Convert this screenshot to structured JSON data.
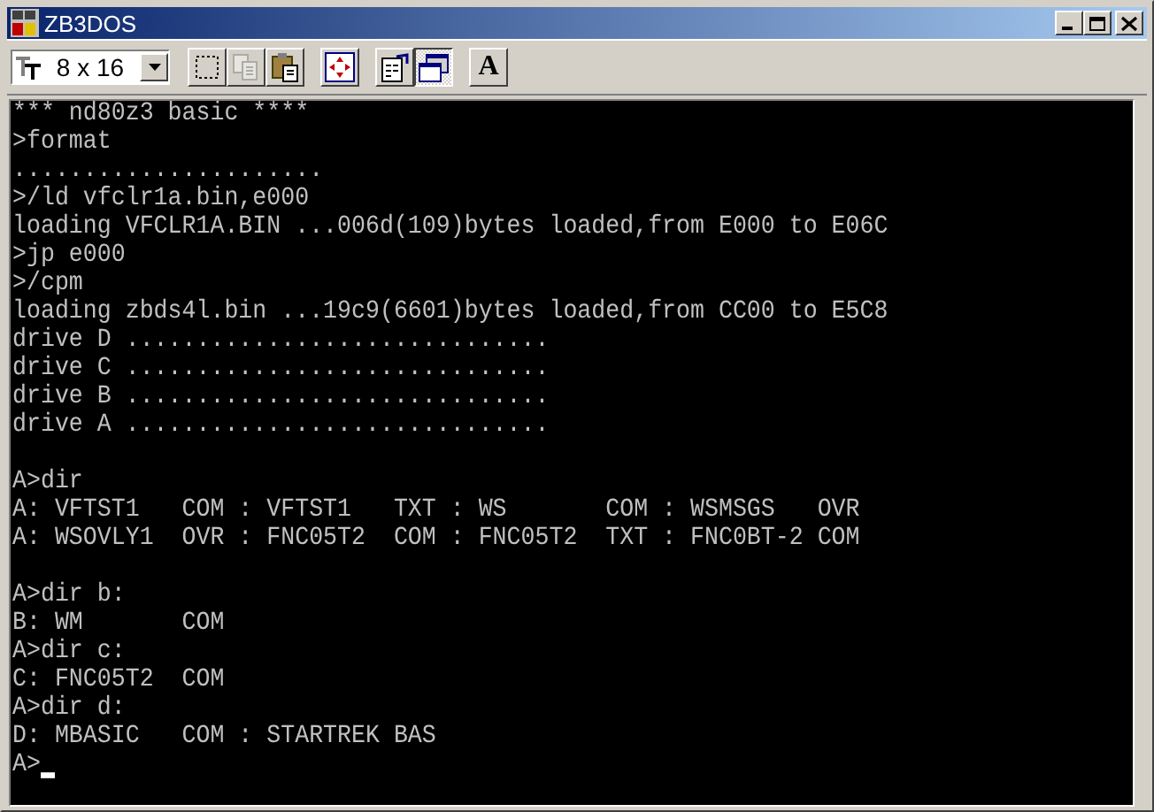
{
  "window": {
    "title": "ZB3DOS",
    "controls": [
      {
        "kind": "minimize"
      },
      {
        "kind": "maximize"
      },
      {
        "kind": "close"
      }
    ]
  },
  "toolbar": {
    "font_size": "8 x 16",
    "buttons": [
      {
        "kind": "mark",
        "pressed": false
      },
      {
        "kind": "copy",
        "pressed": false,
        "disabled": true
      },
      {
        "kind": "paste",
        "pressed": false,
        "disabled": false
      },
      {
        "kind": "fullscreen",
        "pressed": false
      },
      {
        "kind": "properties",
        "pressed": false
      },
      {
        "kind": "background",
        "pressed": true
      },
      {
        "kind": "font",
        "pressed": false,
        "label": "A"
      }
    ]
  },
  "console": {
    "blocks": [
      [
        "*** nd80z3 basic ****",
        ">format",
        "......................",
        ">/ld vfclr1a.bin,e000",
        "loading VFCLR1A.BIN ...006d(109)bytes loaded,from E000 to E06C",
        ">jp e000",
        ">/cpm",
        "loading zbds4l.bin ...19c9(6601)bytes loaded,from CC00 to E5C8",
        "drive D ..............................",
        "drive C ..............................",
        "drive B ..............................",
        "drive A .............................."
      ],
      [
        "A>dir",
        "A: VFTST1   COM : VFTST1   TXT : WS       COM : WSMSGS   OVR",
        "A: WSOVLY1  OVR : FNC05T2  COM : FNC05T2  TXT : FNC0BT-2 COM"
      ],
      [
        "A>dir b:",
        "B: WM       COM",
        "A>dir c:",
        "C: FNC05T2  COM",
        "A>dir d:",
        "D: MBASIC   COM : STARTREK BAS",
        "A>"
      ]
    ],
    "cursor": true
  }
}
